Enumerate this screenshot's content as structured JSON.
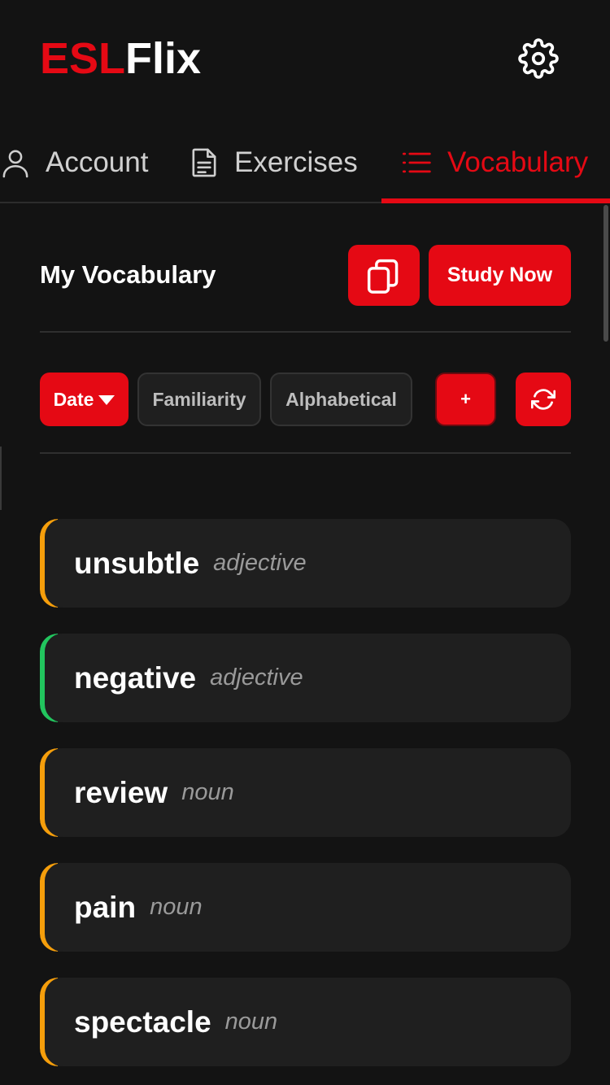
{
  "header": {
    "logo_part1": "ESL",
    "logo_part2": "Flix",
    "settings_icon": "gear-icon"
  },
  "tabs": [
    {
      "label": "Account",
      "icon": "user-icon",
      "active": false
    },
    {
      "label": "Exercises",
      "icon": "document-icon",
      "active": false
    },
    {
      "label": "Vocabulary",
      "icon": "list-icon",
      "active": true
    }
  ],
  "vocabulary": {
    "title": "My Vocabulary",
    "flashcards_icon": "copy-cards-icon",
    "study_now_label": "Study Now",
    "sort": {
      "date_label": "Date",
      "familiarity_label": "Familiarity",
      "alphabetical_label": "Alphabetical"
    },
    "add_label": "+",
    "refresh_icon": "refresh-icon",
    "words": [
      {
        "word": "unsubtle",
        "pos": "adjective",
        "accent": "#f59e0b"
      },
      {
        "word": "negative",
        "pos": "adjective",
        "accent": "#22c55e"
      },
      {
        "word": "review",
        "pos": "noun",
        "accent": "#f59e0b"
      },
      {
        "word": "pain",
        "pos": "noun",
        "accent": "#f59e0b"
      },
      {
        "word": "spectacle",
        "pos": "noun",
        "accent": "#f59e0b"
      }
    ]
  },
  "colors": {
    "brand_red": "#e50914",
    "background": "#131313",
    "card": "#1f1f1f"
  }
}
